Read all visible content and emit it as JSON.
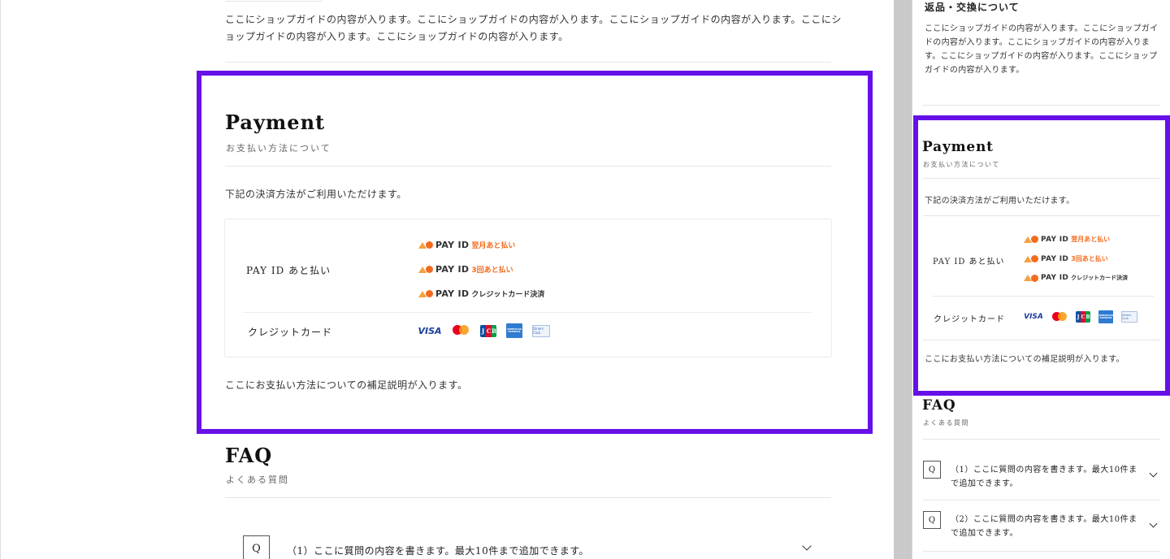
{
  "desktop": {
    "shop_guide_text": "ここにショップガイドの内容が入ります。ここにショップガイドの内容が入ります。ここにショップガイドの内容が入ります。ここにショップガイドの内容が入ります。ここにショップガイドの内容が入ります。",
    "payment": {
      "title": "Payment",
      "subtitle": "お支払い方法について",
      "lead": "下記の決済方法がご利用いただけます。",
      "rows": [
        {
          "label": "PAY ID あと払い"
        },
        {
          "label": "クレジットカード"
        }
      ],
      "note": "ここにお支払い方法についての補足説明が入ります。"
    },
    "faq": {
      "title": "FAQ",
      "subtitle": "よくある質問",
      "items": [
        {
          "q": "Q",
          "text": "（1）ここに質問の内容を書きます。最大10件まで追加できます。"
        }
      ]
    }
  },
  "payid_logos": {
    "brand": "PAY ID",
    "options": [
      "翌月あと払い",
      "3回あと払い",
      "クレジットカード決済"
    ]
  },
  "card_logos": {
    "visa": "VISA",
    "jcb": [
      "J",
      "C",
      "B"
    ],
    "amex": "AMERICAN EXPRESS",
    "diners": "Diners Club"
  },
  "mobile": {
    "return_heading": "返品・交換について",
    "shop_guide_text": "ここにショップガイドの内容が入ります。ここにショップガイドの内容が入ります。ここにショップガイドの内容が入ります。ここにショップガイドの内容が入ります。ここにショップガイドの内容が入ります。",
    "payment": {
      "title": "Payment",
      "subtitle": "お支払い方法について",
      "lead": "下記の決済方法がご利用いただけます。",
      "rows": [
        {
          "label": "PAY ID あと払い"
        },
        {
          "label": "クレジットカード"
        }
      ],
      "note": "ここにお支払い方法についての補足説明が入ります。"
    },
    "faq": {
      "title": "FAQ",
      "subtitle": "よくある質問",
      "items": [
        {
          "q": "Q",
          "text": "（1）ここに質問の内容を書きます。最大10件まで追加できます。"
        },
        {
          "q": "Q",
          "text": "（2）ここに質問の内容を書きます。最大10件まで追加できます。"
        }
      ]
    }
  },
  "colors": {
    "highlight": "#6610e8",
    "payid_orange": "#f26b1d",
    "visa_blue": "#1a3b9c"
  }
}
